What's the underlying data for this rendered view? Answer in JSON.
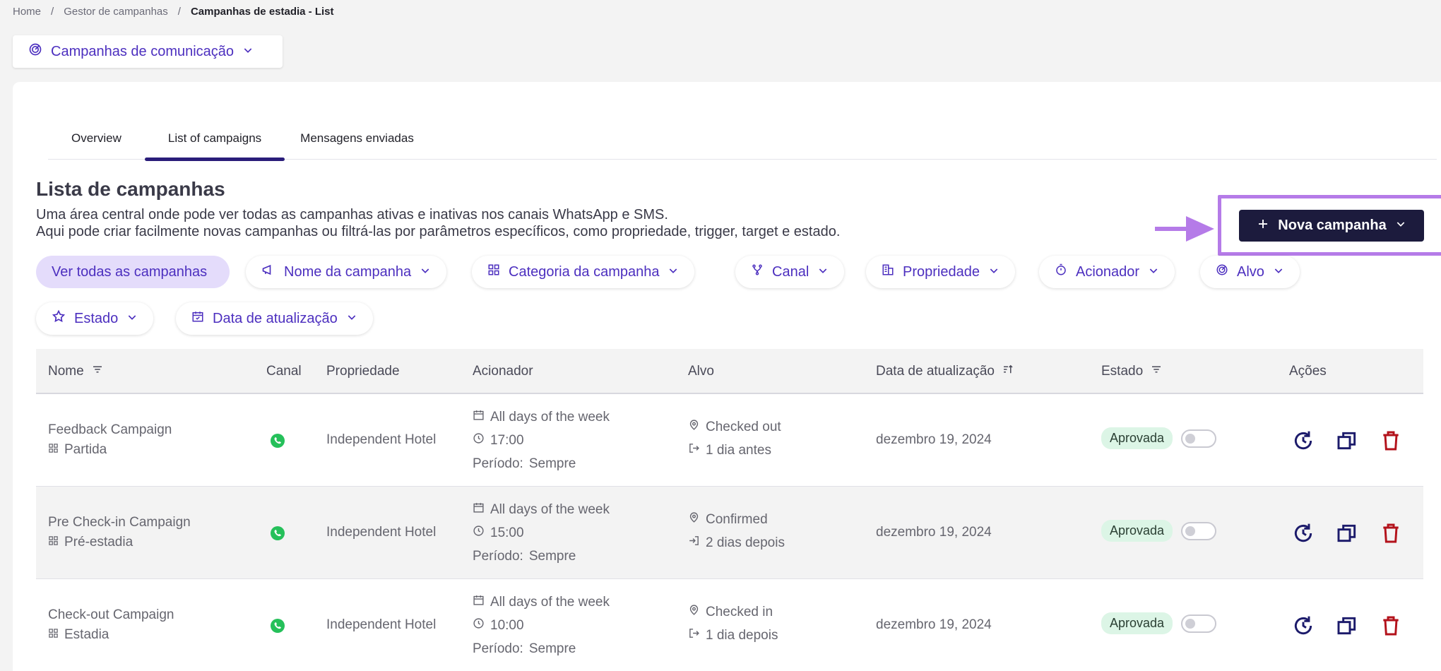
{
  "breadcrumb": {
    "home": "Home",
    "manager": "Gestor de campanhas",
    "current": "Campanhas de estadia - List",
    "separator": "/"
  },
  "module_select": {
    "label": "Campanhas de comunicação"
  },
  "tabs": [
    {
      "label": "Overview",
      "active": false
    },
    {
      "label": "List of campaigns",
      "active": true
    },
    {
      "label": "Mensagens enviadas",
      "active": false
    }
  ],
  "section": {
    "title": "Lista de campanhas",
    "desc_line1": "Uma área central onde pode ver todas as campanhas ativas e inativas nos canais WhatsApp e SMS.",
    "desc_line2": "Aqui pode criar facilmente novas campanhas ou filtrá-las por parâmetros específicos, como propriedade, trigger, target e estado."
  },
  "new_button": {
    "label": "Nova campanha"
  },
  "filters": {
    "all": "Ver todas as campanhas",
    "name": "Nome da campanha",
    "category": "Categoria da campanha",
    "channel": "Canal",
    "property": "Propriedade",
    "trigger": "Acionador",
    "target": "Alvo",
    "state": "Estado",
    "updated": "Data de atualização"
  },
  "table": {
    "headers": {
      "name": "Nome",
      "channel": "Canal",
      "property": "Propriedade",
      "trigger": "Acionador",
      "target": "Alvo",
      "updated": "Data de atualização",
      "state": "Estado",
      "actions": "Ações"
    },
    "rows": [
      {
        "name": "Feedback Campaign",
        "category": "Partida",
        "property": "Independent Hotel",
        "days": "All days of the week",
        "time": "17:00",
        "period_label": "Período:",
        "period_value": "Sempre",
        "target_status": "Checked out",
        "target_offset": "1 dia antes",
        "updated": "dezembro 19, 2024",
        "state": "Aprovada"
      },
      {
        "name": "Pre Check-in Campaign",
        "category": "Pré-estadia",
        "property": "Independent Hotel",
        "days": "All days of the week",
        "time": "15:00",
        "period_label": "Período:",
        "period_value": "Sempre",
        "target_status": "Confirmed",
        "target_offset": "2 dias depois",
        "updated": "dezembro 19, 2024",
        "state": "Aprovada"
      },
      {
        "name": "Check-out Campaign",
        "category": "Estadia",
        "property": "Independent Hotel",
        "days": "All days of the week",
        "time": "10:00",
        "period_label": "Período:",
        "period_value": "Sempre",
        "target_status": "Checked in",
        "target_offset": "1 dia depois",
        "updated": "dezembro 19, 2024",
        "state": "Aprovada"
      }
    ]
  },
  "colors": {
    "accent": "#4c2fbf",
    "primary_button": "#1c1b3d",
    "highlight": "#b57be8",
    "approved_badge": "#dcf5e6",
    "whatsapp": "#25c05a",
    "delete": "#b3121b",
    "action_icon": "#1c1b6b"
  }
}
